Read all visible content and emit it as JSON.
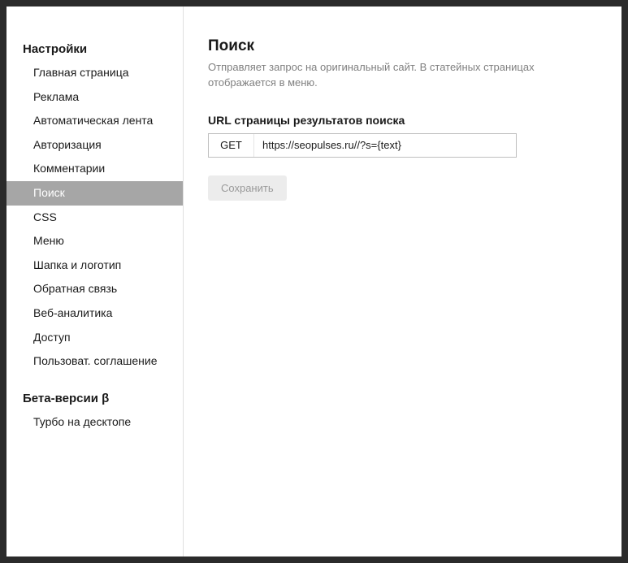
{
  "sidebar": {
    "section1": {
      "title": "Настройки",
      "items": [
        {
          "label": "Главная страница"
        },
        {
          "label": "Реклама"
        },
        {
          "label": "Автоматическая лента"
        },
        {
          "label": "Авторизация"
        },
        {
          "label": "Комментарии"
        },
        {
          "label": "Поиск"
        },
        {
          "label": "CSS"
        },
        {
          "label": "Меню"
        },
        {
          "label": "Шапка и логотип"
        },
        {
          "label": "Обратная связь"
        },
        {
          "label": "Веб-аналитика"
        },
        {
          "label": "Доступ"
        },
        {
          "label": "Пользоват. соглашение"
        }
      ]
    },
    "section2": {
      "title": "Бета-версии β",
      "items": [
        {
          "label": "Турбо на десктопе"
        }
      ]
    }
  },
  "main": {
    "title": "Поиск",
    "subtitle": "Отправляет запрос на оригинальный сайт. В статейных страницах отображается в меню.",
    "field_label": "URL страницы результатов поиска",
    "method": "GET",
    "url_value": "https://seopulses.ru//?s={text}",
    "save_label": "Сохранить"
  }
}
